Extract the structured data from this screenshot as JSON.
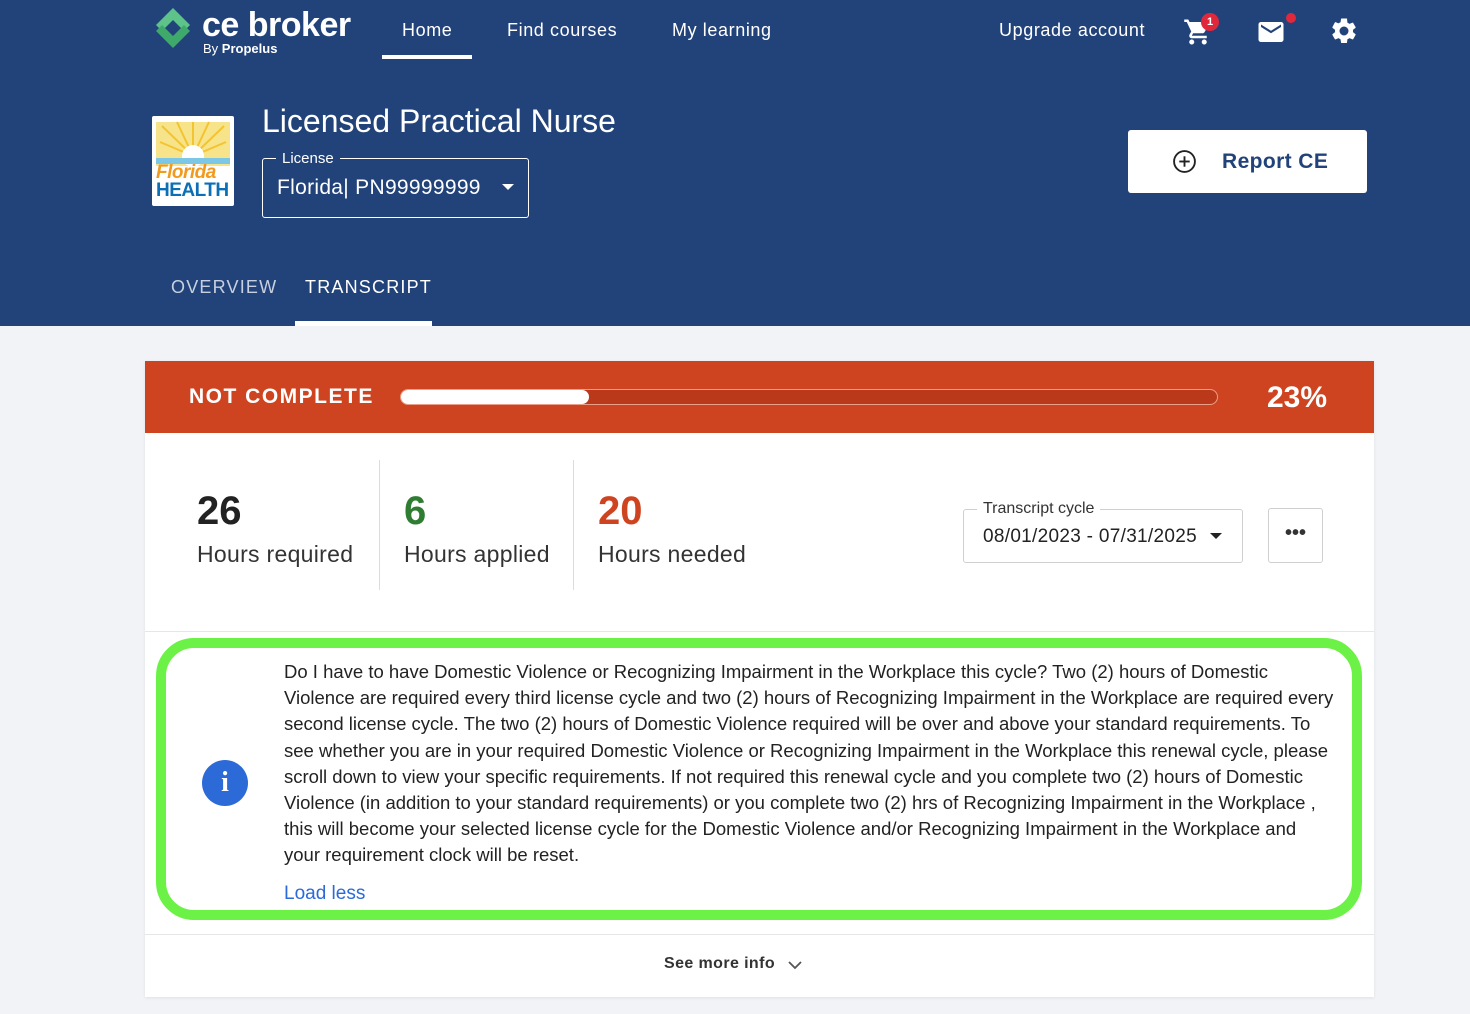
{
  "brand": {
    "name": "ce broker",
    "sub_prefix": "By ",
    "sub_brand": "Propelus"
  },
  "nav": {
    "home": "Home",
    "find_courses": "Find courses",
    "my_learning": "My learning",
    "upgrade": "Upgrade account",
    "cart_count": "1"
  },
  "license": {
    "logo_line1": "Florida",
    "logo_line2": "HEALTH",
    "title": "Licensed Practical Nurse",
    "select_label": "License",
    "select_value": "Florida| PN99999999"
  },
  "report_button": "Report CE",
  "tabs": {
    "overview": "OVERVIEW",
    "transcript": "TRANSCRIPT"
  },
  "status": {
    "label": "NOT COMPLETE",
    "percent_text": "23%",
    "progress": 0.23
  },
  "stats": {
    "required": {
      "value": "26",
      "label": "Hours required"
    },
    "applied": {
      "value": "6",
      "label": "Hours applied"
    },
    "needed": {
      "value": "20",
      "label": "Hours needed"
    }
  },
  "cycle": {
    "label": "Transcript cycle",
    "value": "08/01/2023 - 07/31/2025"
  },
  "more_button": "•••",
  "info": {
    "icon": "i",
    "text": "Do I have to have Domestic Violence or Recognizing Impairment in the Workplace this cycle? Two (2) hours of Domestic Violence are required every third license cycle and two (2) hours of Recognizing Impairment in the Workplace are required every second license cycle. The two (2) hours of Domestic Violence required will be over and above your standard requirements. To see whether you are in your required Domestic Violence or Recognizing Impairment in the Workplace this renewal cycle, please scroll down to view your specific requirements. If not required this renewal cycle and you complete two (2) hours of Domestic Violence (in addition to your standard requirements) or you complete two (2) hrs of Recognizing Impairment in the Workplace , this will become your selected license cycle for the Domestic Violence and/or Recognizing Impairment in the Workplace and your requirement clock will be reset.",
    "load_less": "Load less"
  },
  "see_more": "See more info",
  "colors": {
    "header_bg": "#22437a",
    "status_bg": "#cf4420",
    "applied": "#2e7d32",
    "needed": "#cf4420",
    "highlight": "#6cf246",
    "link": "#2c6ad8"
  }
}
